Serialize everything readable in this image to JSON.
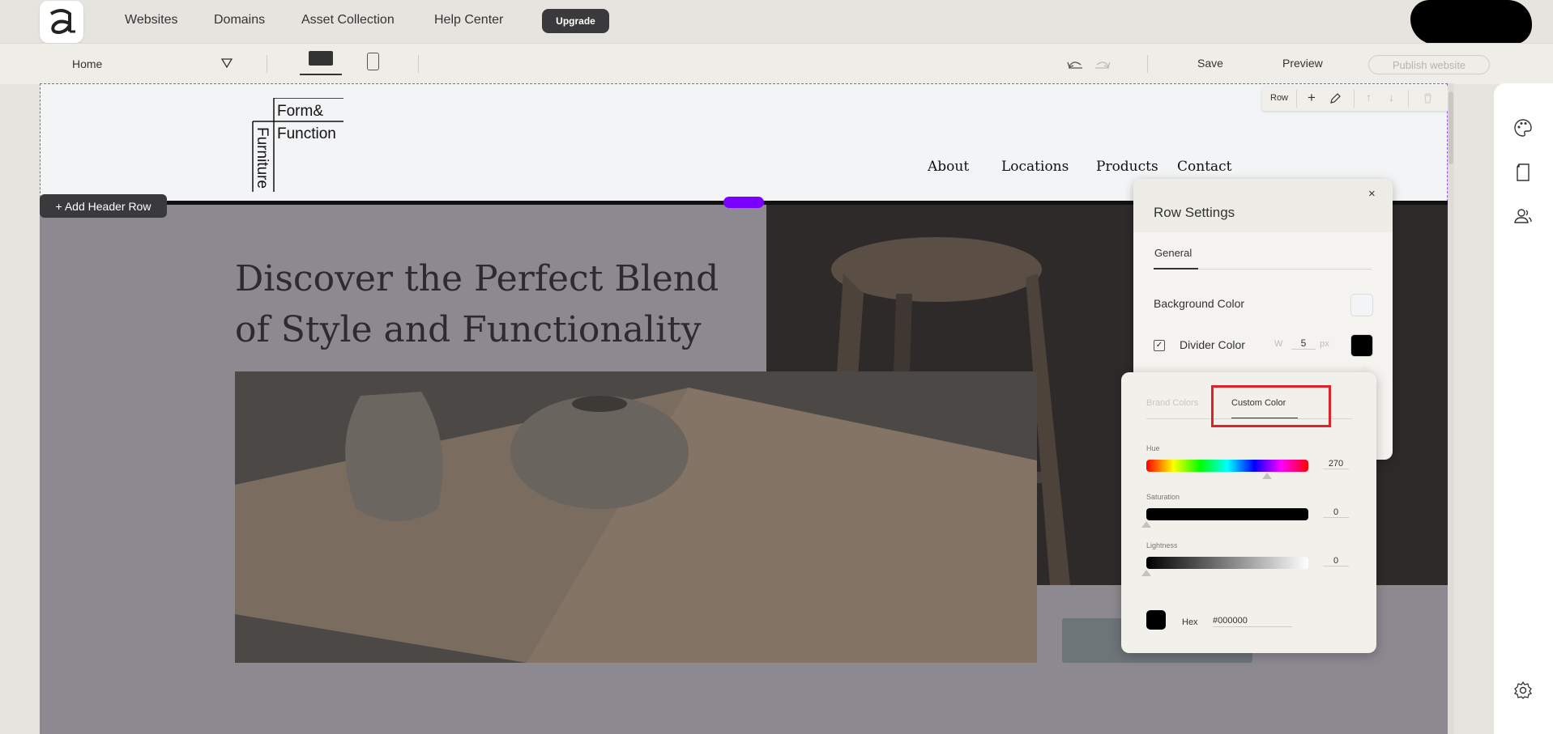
{
  "topnav": {
    "links": [
      "Websites",
      "Domains",
      "Asset Collection",
      "Help Center"
    ],
    "upgrade": "Upgrade"
  },
  "toolbar": {
    "page": "Home",
    "save": "Save",
    "preview": "Preview",
    "publish": "Publish website"
  },
  "site": {
    "logo_top": "Form&",
    "logo_mid": "Function",
    "logo_side": "Furniture",
    "nav": [
      "About",
      "Locations",
      "Products",
      "Contact"
    ],
    "hero_title": "Discover the Perfect Blend of Style and Functionality"
  },
  "editor": {
    "row_label": "Row",
    "add_header_row": "+ Add Header Row"
  },
  "row_settings": {
    "title": "Row Settings",
    "close": "×",
    "tab": "General",
    "background_color_label": "Background Color",
    "background_color": "#f3f4f6",
    "divider_color_label": "Divider Color",
    "divider_enabled": true,
    "width_label": "W",
    "width_value": "5",
    "width_unit": "px",
    "divider_color": "#000000"
  },
  "color_picker": {
    "tab_brand": "Brand Colors",
    "tab_custom": "Custom Color",
    "hue_label": "Hue",
    "hue_value": "270",
    "saturation_label": "Saturation",
    "saturation_value": "0",
    "lightness_label": "Lightness",
    "lightness_value": "0",
    "hex_label": "Hex",
    "hex_value": "#000000"
  },
  "colors": {
    "accent_purple": "#7b00ff",
    "highlight_red": "#e0202a",
    "dark_button": "#3a3a3c"
  }
}
